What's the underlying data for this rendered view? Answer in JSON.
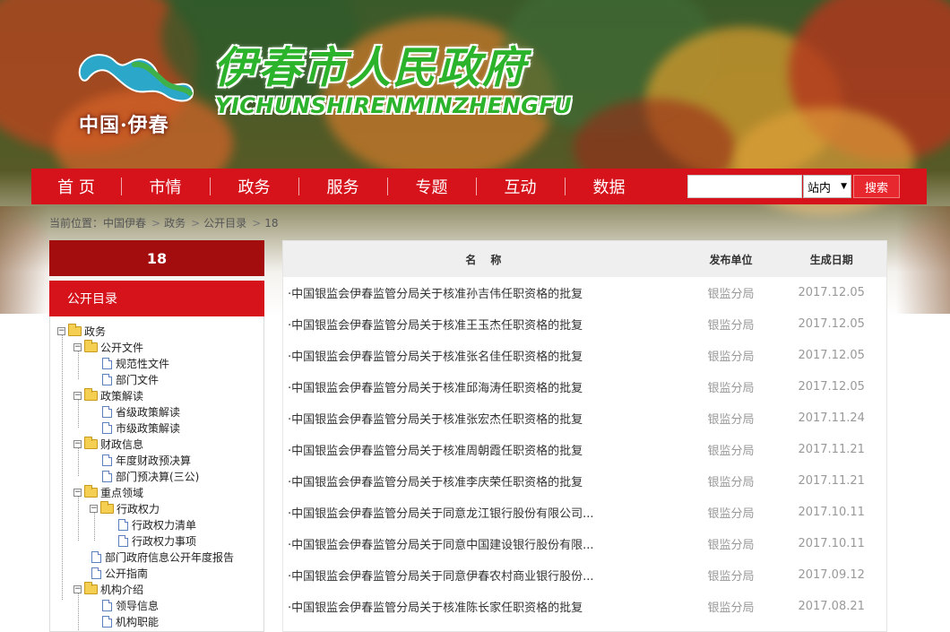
{
  "header": {
    "logo_text": "中国·伊春",
    "site_title": "伊春市人民政府",
    "site_subtitle": "YICHUNSHIRENMINZHENGFU"
  },
  "nav": {
    "items": [
      "首 页",
      "市情",
      "政务",
      "服务",
      "专题",
      "互动",
      "数据"
    ],
    "search_placeholder": "",
    "scope_value": "站内",
    "search_label": "搜索"
  },
  "breadcrumb": {
    "prefix": "当前位置：",
    "items": [
      "中国伊春",
      "政务",
      "公开目录",
      "18"
    ]
  },
  "sidebar": {
    "title": "18",
    "subtitle": "公开目录",
    "tree": [
      {
        "label": "政务",
        "type": "folder",
        "toggle": "−"
      },
      {
        "label": "公开文件",
        "type": "folder",
        "toggle": "−"
      },
      {
        "label": "规范性文件",
        "type": "doc"
      },
      {
        "label": "部门文件",
        "type": "doc"
      },
      {
        "label": "政策解读",
        "type": "folder",
        "toggle": "−"
      },
      {
        "label": "省级政策解读",
        "type": "doc"
      },
      {
        "label": "市级政策解读",
        "type": "doc"
      },
      {
        "label": "财政信息",
        "type": "folder",
        "toggle": "−"
      },
      {
        "label": "年度财政预决算",
        "type": "doc"
      },
      {
        "label": "部门预决算(三公)",
        "type": "doc"
      },
      {
        "label": "重点领域",
        "type": "folder",
        "toggle": "−"
      },
      {
        "label": "行政权力",
        "type": "folder",
        "toggle": "−"
      },
      {
        "label": "行政权力清单",
        "type": "doc"
      },
      {
        "label": "行政权力事项",
        "type": "doc"
      },
      {
        "label": "部门政府信息公开年度报告",
        "type": "doc"
      },
      {
        "label": "公开指南",
        "type": "doc"
      },
      {
        "label": "机构介绍",
        "type": "folder",
        "toggle": "−"
      },
      {
        "label": "领导信息",
        "type": "doc"
      },
      {
        "label": "机构职能",
        "type": "doc"
      }
    ]
  },
  "table": {
    "headers": {
      "name": "名　称",
      "unit": "发布单位",
      "date": "生成日期"
    },
    "rows": [
      {
        "name": "·中国银监会伊春监管分局关于核准孙吉伟任职资格的批复",
        "unit": "银监分局",
        "date": "2017.12.05"
      },
      {
        "name": "·中国银监会伊春监管分局关于核准王玉杰任职资格的批复",
        "unit": "银监分局",
        "date": "2017.12.05"
      },
      {
        "name": "·中国银监会伊春监管分局关于核准张名佳任职资格的批复",
        "unit": "银监分局",
        "date": "2017.12.05"
      },
      {
        "name": "·中国银监会伊春监管分局关于核准邱海涛任职资格的批复",
        "unit": "银监分局",
        "date": "2017.12.05"
      },
      {
        "name": "·中国银监会伊春监管分局关于核准张宏杰任职资格的批复",
        "unit": "银监分局",
        "date": "2017.11.24"
      },
      {
        "name": "·中国银监会伊春监管分局关于核准周朝霞任职资格的批复",
        "unit": "银监分局",
        "date": "2017.11.21"
      },
      {
        "name": "·中国银监会伊春监管分局关于核准李庆荣任职资格的批复",
        "unit": "银监分局",
        "date": "2017.11.21"
      },
      {
        "name": "·中国银监会伊春监管分局关于同意龙江银行股份有限公司...",
        "unit": "银监分局",
        "date": "2017.10.11"
      },
      {
        "name": "·中国银监会伊春监管分局关于同意中国建设银行股份有限...",
        "unit": "银监分局",
        "date": "2017.10.11"
      },
      {
        "name": "·中国银监会伊春监管分局关于同意伊春农村商业银行股份...",
        "unit": "银监分局",
        "date": "2017.09.12"
      },
      {
        "name": "·中国银监会伊春监管分局关于核准陈长家任职资格的批复",
        "unit": "银监分局",
        "date": "2017.08.21"
      }
    ]
  },
  "colors": {
    "nav_red": "#d6121b",
    "sidebar_dark_red": "#a30d0d",
    "title_green": "#2bb32b",
    "muted_text": "#999999"
  }
}
